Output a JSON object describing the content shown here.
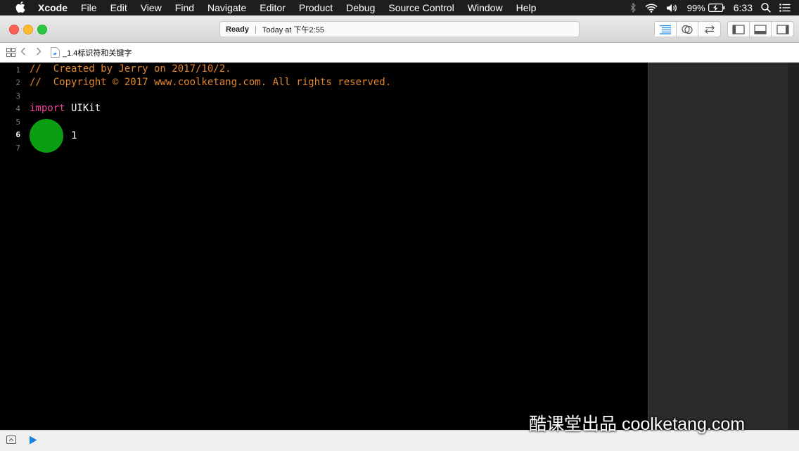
{
  "menubar": {
    "app": "Xcode",
    "items": [
      "File",
      "Edit",
      "View",
      "Find",
      "Navigate",
      "Editor",
      "Product",
      "Debug",
      "Source Control",
      "Window",
      "Help"
    ],
    "battery": "99%",
    "time": "6:33"
  },
  "toolbar": {
    "status": "Ready",
    "activity": "Today at 下午2:55"
  },
  "jumpbar": {
    "file": "_1.4标识符和关键字"
  },
  "editor": {
    "line_numbers": [
      "1",
      "2",
      "3",
      "4",
      "5",
      "6",
      "7"
    ],
    "current_line": "6",
    "lines": {
      "l1": "//  Created by Jerry on 2017/10/2.",
      "l2": "//  Copyright © 2017 www.coolketang.com. All rights reserved.",
      "l4_keyword": "import",
      "l4_rest": " UIKit",
      "l6_text": "1"
    }
  },
  "watermark": "酷课堂出品 coolketang.com",
  "colors": {
    "comment": "#e3852a",
    "keyword": "#f2449a",
    "indicator": "#0a9f13",
    "accent": "#1a82e2"
  }
}
